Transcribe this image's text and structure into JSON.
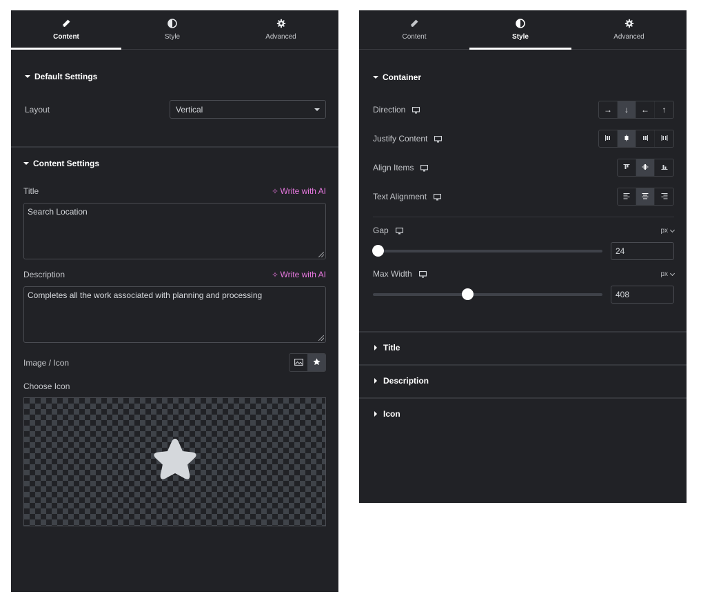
{
  "left_panel": {
    "tabs": [
      {
        "label": "Content",
        "icon": "pencil-icon",
        "active": true
      },
      {
        "label": "Style",
        "icon": "half-circle-icon",
        "active": false
      },
      {
        "label": "Advanced",
        "icon": "gear-icon",
        "active": false
      }
    ],
    "default_settings": {
      "heading": "Default Settings",
      "layout_label": "Layout",
      "layout_value": "Vertical"
    },
    "content_settings": {
      "heading": "Content Settings",
      "title_label": "Title",
      "title_value": "Search Location",
      "description_label": "Description",
      "description_value": "Completes all the work associated with planning and processing",
      "ai_link": "Write with AI",
      "image_icon_label": "Image / Icon",
      "image_icon_options": [
        {
          "name": "image-icon",
          "active": false
        },
        {
          "name": "star-icon",
          "active": true
        }
      ],
      "choose_icon_label": "Choose Icon",
      "selected_icon": "star-icon"
    }
  },
  "right_panel": {
    "tabs": [
      {
        "label": "Content",
        "icon": "pencil-icon",
        "active": false
      },
      {
        "label": "Style",
        "icon": "half-circle-icon",
        "active": true
      },
      {
        "label": "Advanced",
        "icon": "gear-icon",
        "active": false
      }
    ],
    "container": {
      "heading": "Container",
      "direction": {
        "label": "Direction",
        "options": [
          "→",
          "↓",
          "←",
          "↑"
        ],
        "active": 1
      },
      "justify_content": {
        "label": "Justify Content",
        "options": [
          "justify-start",
          "justify-center",
          "justify-end",
          "justify-space-between"
        ],
        "active": 1
      },
      "align_items": {
        "label": "Align Items",
        "options": [
          "align-start",
          "align-center",
          "align-end"
        ],
        "active": 1
      },
      "text_alignment": {
        "label": "Text Alignment",
        "options": [
          "align-left",
          "align-center",
          "align-right"
        ],
        "active": 1
      },
      "gap": {
        "label": "Gap",
        "unit": "px",
        "value": "24",
        "slider_fraction": 0.02
      },
      "max_width": {
        "label": "Max Width",
        "unit": "px",
        "value": "408",
        "slider_fraction": 0.41
      }
    },
    "collapsed_sections": [
      "Title",
      "Description",
      "Icon"
    ]
  },
  "colors": {
    "panel_bg": "#212226",
    "ai_accent": "#e878e0",
    "active_button_bg": "#3f4249"
  }
}
